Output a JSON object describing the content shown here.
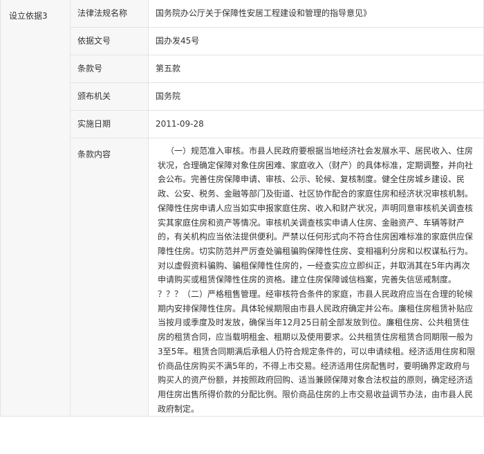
{
  "basis": {
    "group_label": "设立依据3",
    "rows": [
      {
        "label": "法律法规名称",
        "value": "国务院办公厅关于保障性安居工程建设和管理的指导意见》"
      },
      {
        "label": "依据文号",
        "value": "国办发45号"
      },
      {
        "label": "条款号",
        "value": "第五款"
      },
      {
        "label": "颁布机关",
        "value": "国务院"
      },
      {
        "label": "实施日期",
        "value": "2011-09-28"
      }
    ],
    "content_label": "条款内容",
    "content_paragraphs": [
      "（一）规范准入审核。市县人民政府要根据当地经济社会发展水平、居民收入、住房状况，合理确定保障对象住房困难、家庭收入（财产）的具体标准，定期调整，并向社会公布。完善住房保障申请、审核、公示、轮候、复核制度。健全住房城乡建设、民政、公安、税务、金融等部门及街道、社区协作配合的家庭住房和经济状况审核机制。保障性住房申请人应当如实申报家庭住房、收入和财产状况，声明同意审核机关调查核实其家庭住房和资产等情况。审核机关调查核实申请人住房、金融资产、车辆等财产的，有关机构应当依法提供便利。严禁以任何形式向不符合住房困难标准的家庭供应保障性住房。切实防范并严厉查处骗租骗购保障性住房、变相福利分房和以权谋私行为。对以虚假资料骗购、骗租保障性住房的，一经查实应立即纠正，并取消其在5年内再次申请购买或租赁保障性住房的资格。建立住房保障诚信档案，完善失信惩戒制度。",
      "？？？（二）严格租售管理。经审核符合条件的家庭，市县人民政府应当在合理的轮候期内安排保障性住房。具体轮候期限由市县人民政府确定并公布。廉租住房租赁补贴应当按月或季度及时发放，确保当年12月25日前全部发放到位。廉租住房、公共租赁住房的租赁合同，应当载明租金、租期以及使用要求。公共租赁住房租赁合同期限一般为3至5年。租赁合同期满后承租人仍符合规定条件的，可以申请续租。经济适用住房和限价商品住房购买不满5年的，不得上市交易。经济适用住房配售时，要明确界定政府与购买人的资产份额，并按照政府回购、适当兼顾保障对象合法权益的原则，确定经济适用住房出售所得价款的分配比例。限价商品住房的上市交易收益调节办法，由市县人民政府制定。"
    ]
  }
}
